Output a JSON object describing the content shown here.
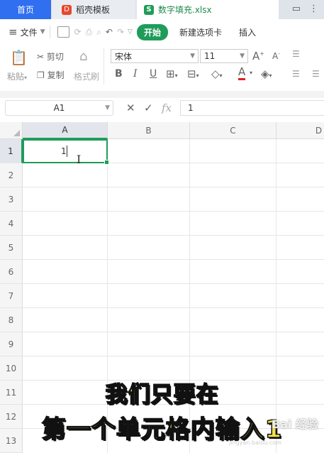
{
  "tabs": {
    "home": "首页",
    "daoke": "稻壳模板",
    "file": "数字填充.xlsx",
    "daoke_icon": "daoke-logo-icon",
    "sheet_icon": "spreadsheet-icon"
  },
  "menubar": {
    "menu_label": "文件",
    "start": "开始",
    "new_tab": "新建选项卡",
    "insert": "插入"
  },
  "ribbon": {
    "paste": "粘贴",
    "cut": "剪切",
    "copy": "复制",
    "format_painter": "格式刷",
    "font_name": "宋体",
    "font_size": "11",
    "bold": "B",
    "italic": "I",
    "underline": "U"
  },
  "formula": {
    "cell_ref": "A1",
    "fx": "fx",
    "content": "1"
  },
  "sheet": {
    "columns": [
      "A",
      "B",
      "C",
      "D"
    ],
    "rows": [
      "1",
      "2",
      "3",
      "4",
      "5",
      "6",
      "7",
      "8",
      "9",
      "10",
      "11",
      "12",
      "13"
    ],
    "active_cell_value": "1"
  },
  "overlay": {
    "subtitle_line1": "我们只要在",
    "subtitle_line2": "第一个单元格内输入1",
    "watermark": "Bai 经验",
    "watermark_url": "jingyan.baidu.com"
  },
  "colors": {
    "brand_green": "#1f9c5a",
    "home_tab_blue": "#2f6ff0",
    "subtitle_yellow": "#f3e14a"
  }
}
